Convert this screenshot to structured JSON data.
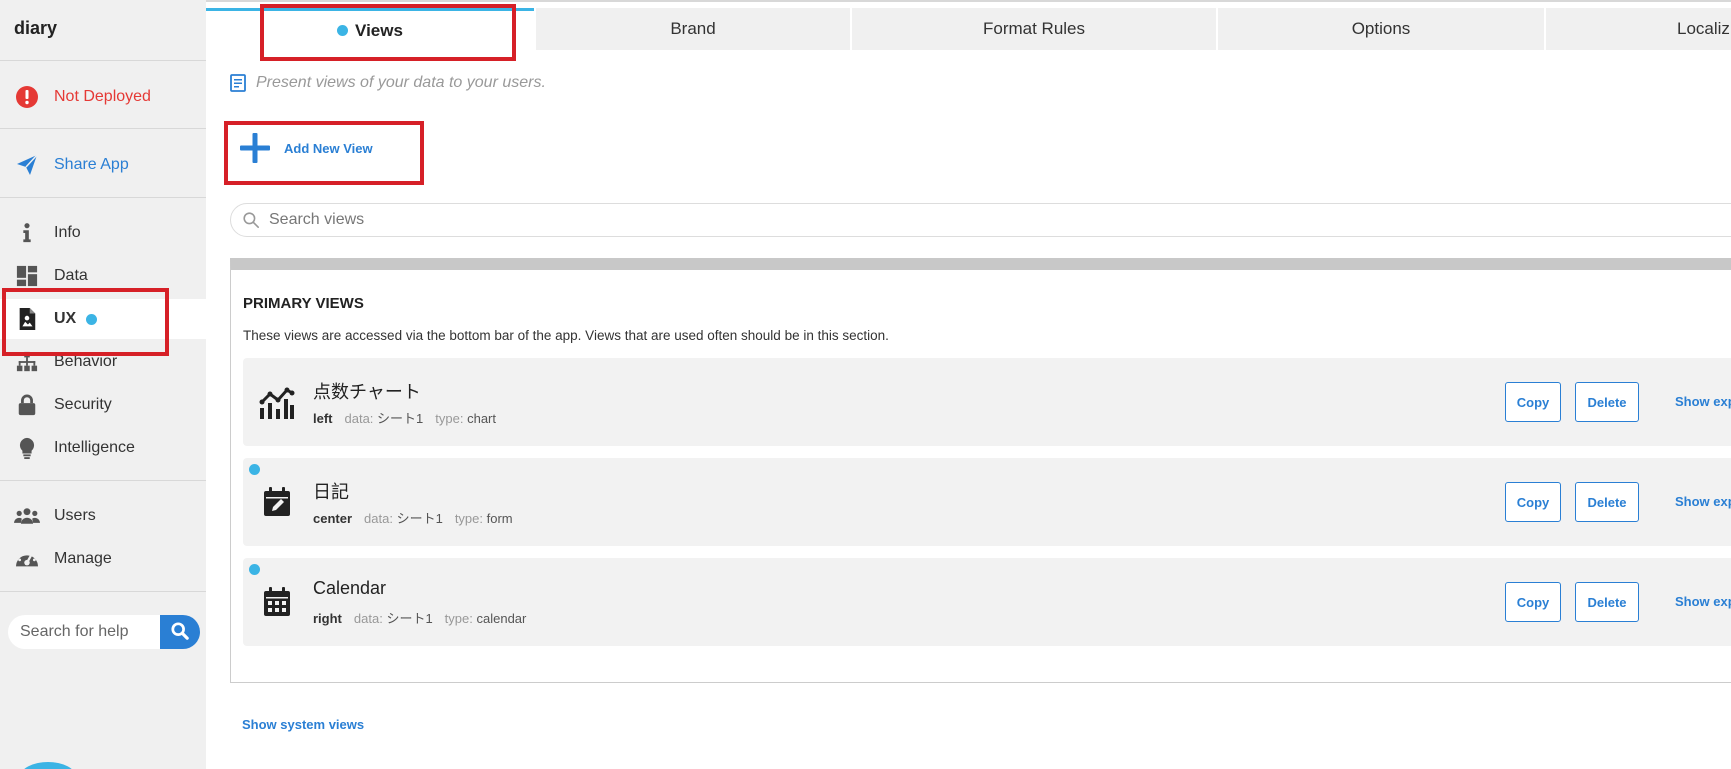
{
  "app": {
    "name": "diary"
  },
  "sidebar": {
    "status": "Not Deployed",
    "share": "Share App",
    "items": [
      {
        "label": "Info",
        "icon": "info-icon"
      },
      {
        "label": "Data",
        "icon": "grid-icon"
      },
      {
        "label": "UX",
        "icon": "ux-icon"
      },
      {
        "label": "Behavior",
        "icon": "hierarchy-icon"
      },
      {
        "label": "Security",
        "icon": "lock-icon"
      },
      {
        "label": "Intelligence",
        "icon": "lightbulb-icon"
      },
      {
        "label": "Users",
        "icon": "users-icon"
      },
      {
        "label": "Manage",
        "icon": "gauge-icon"
      }
    ],
    "search_placeholder": "Search for help"
  },
  "tabs": [
    {
      "label": "Views"
    },
    {
      "label": "Brand"
    },
    {
      "label": "Format Rules"
    },
    {
      "label": "Options"
    },
    {
      "label": "Localiz"
    }
  ],
  "main": {
    "description": "Present views of your data to your users.",
    "add_view": "Add New View",
    "search_placeholder": "Search views",
    "primary": {
      "title": "PRIMARY VIEWS",
      "description": "These views are accessed via the bottom bar of the app. Views that are used often should be in this section.",
      "views": [
        {
          "name": "点数チャート",
          "position": "left",
          "data_label": "data:",
          "data": "シート1",
          "type_label": "type:",
          "type": "chart",
          "icon": "chart-icon"
        },
        {
          "name": "日記",
          "position": "center",
          "data_label": "data:",
          "data": "シート1",
          "type_label": "type:",
          "type": "form",
          "icon": "calendar-edit-icon"
        },
        {
          "name": "Calendar",
          "position": "right",
          "data_label": "data:",
          "data": "シート1",
          "type_label": "type:",
          "type": "calendar",
          "icon": "calendar-icon"
        }
      ],
      "copy_label": "Copy",
      "delete_label": "Delete",
      "show_label": "Show exp"
    },
    "show_system": "Show system views"
  },
  "colors": {
    "accent": "#3bb4e5",
    "link": "#2a7fd4",
    "error": "#e53935",
    "highlight": "#d62027"
  }
}
